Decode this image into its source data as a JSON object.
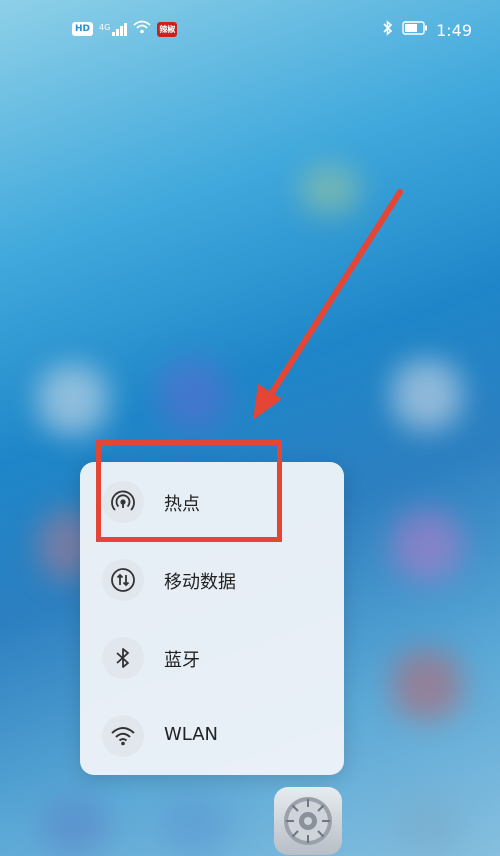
{
  "status_bar": {
    "hd_label": "HD",
    "network_label": "4G",
    "app_badge": "辣椒",
    "time": "1:49"
  },
  "quick_menu": {
    "items": [
      {
        "label": "热点",
        "icon": "hotspot-icon"
      },
      {
        "label": "移动数据",
        "icon": "mobile-data-icon"
      },
      {
        "label": "蓝牙",
        "icon": "bluetooth-icon"
      },
      {
        "label": "WLAN",
        "icon": "wifi-icon"
      }
    ]
  },
  "dock": {
    "settings_icon": "settings-gear-icon"
  },
  "annotation": {
    "highlight_color": "#e54535"
  }
}
